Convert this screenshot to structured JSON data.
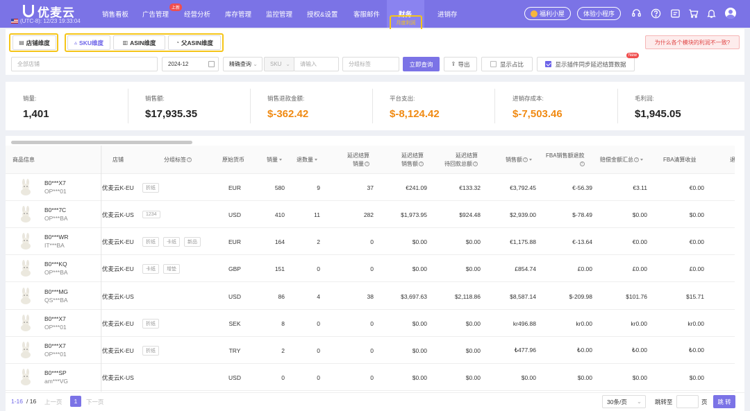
{
  "nav": {
    "logo": "优麦云",
    "timezone": "(UTC-8): 12/23 19:33:04",
    "menu": [
      "销售看板",
      "广告管理",
      "经营分析",
      "库存管理",
      "监控管理",
      "授权&设置",
      "客服邮件",
      "财务",
      "进销存"
    ],
    "ad_badge": "上新",
    "active_submenu": "月度利润",
    "benefits": "福利小屋",
    "miniprogram": "体验小程序",
    "icons": [
      "support-icon",
      "help-icon",
      "message-icon",
      "cart-icon",
      "bell-icon",
      "avatar-icon"
    ]
  },
  "dims": {
    "store": "店铺维度",
    "sku": "SKU维度",
    "asin": "ASIN维度",
    "parent_asin": "父ASIN维度"
  },
  "warning": "为什么各个模块的利润不一致?",
  "filters": {
    "store_placeholder": "全部店铺",
    "month": "2024-12",
    "match": "精确查询",
    "field": "SKU",
    "keyword_placeholder": "请输入",
    "tag_placeholder": "分组标签",
    "query": "立即查询",
    "export": "导出",
    "show_ratio": "显示占比",
    "show_plugin": "显示插件同步延迟结算数据",
    "new_tag": "New"
  },
  "summary": [
    {
      "label": "销量:",
      "value": "1,401",
      "color": "normal"
    },
    {
      "label": "销售额:",
      "value": "$17,935.35",
      "color": "normal"
    },
    {
      "label": "销售退款金额:",
      "value": "$-362.42",
      "color": "orange"
    },
    {
      "label": "平台支出:",
      "value": "$-8,124.42",
      "color": "orange"
    },
    {
      "label": "进销存成本:",
      "value": "$-7,503.46",
      "color": "orange"
    },
    {
      "label": "毛利润:",
      "value": "$1,945.05",
      "color": "normal"
    }
  ],
  "table": {
    "headers": {
      "product": "商品信息",
      "store": "店铺",
      "tags": "分组标签",
      "currency": "原始货币",
      "qty": "销量",
      "refund_qty": "退数量",
      "delay_qty_1": "延迟结算",
      "delay_qty_2": "销量",
      "delay_amt_1": "延迟结算",
      "delay_amt_2": "销售额",
      "delay_pending_1": "延迟结算",
      "delay_pending_2": "待回款总额",
      "sales": "销售额",
      "fba_refund_1": "FBA销售额退款",
      "comp": "赔偿金额汇总",
      "fba_liq": "FBA清算收益",
      "more": "退"
    },
    "rows": [
      {
        "asin": "B0***X7",
        "sku": "OP***01",
        "store": "优麦云K-EU",
        "tags": [
          "折纸"
        ],
        "currency": "EUR",
        "qty": "580",
        "refund": "9",
        "dqty": "37",
        "damt": "€241.09",
        "dpend": "€133.32",
        "sales": "€3,792.45",
        "fba_refund": "€-56.39",
        "comp": "€3.11",
        "liq": "€0.00"
      },
      {
        "asin": "B0***7C",
        "sku": "OP***BA",
        "store": "优麦云K-US",
        "tags": [
          "1234"
        ],
        "currency": "USD",
        "qty": "410",
        "refund": "11",
        "dqty": "282",
        "damt": "$1,973.95",
        "dpend": "$924.48",
        "sales": "$2,939.00",
        "fba_refund": "$-78.49",
        "comp": "$0.00",
        "liq": "$0.00"
      },
      {
        "asin": "B0***WR",
        "sku": "IT***BA",
        "store": "优麦云K-EU",
        "tags": [
          "折纸",
          "卡纸",
          "新品"
        ],
        "currency": "EUR",
        "qty": "164",
        "refund": "2",
        "dqty": "0",
        "damt": "$0.00",
        "dpend": "$0.00",
        "sales": "€1,175.88",
        "fba_refund": "€-13.64",
        "comp": "€0.00",
        "liq": "€0.00"
      },
      {
        "asin": "B0***KQ",
        "sku": "OP***BA",
        "store": "优麦云K-EU",
        "tags": [
          "卡纸",
          "增垫"
        ],
        "currency": "GBP",
        "qty": "151",
        "refund": "0",
        "dqty": "0",
        "damt": "$0.00",
        "dpend": "$0.00",
        "sales": "£854.74",
        "fba_refund": "£0.00",
        "comp": "£0.00",
        "liq": "£0.00"
      },
      {
        "asin": "B0***MG",
        "sku": "QS***BA",
        "store": "优麦云K-US",
        "tags": [],
        "currency": "USD",
        "qty": "86",
        "refund": "4",
        "dqty": "38",
        "damt": "$3,697.63",
        "dpend": "$2,118.86",
        "sales": "$8,587.14",
        "fba_refund": "$-209.98",
        "comp": "$101.76",
        "liq": "$15.71"
      },
      {
        "asin": "B0***X7",
        "sku": "OP***01",
        "store": "优麦云K-EU",
        "tags": [
          "折纸"
        ],
        "currency": "SEK",
        "qty": "8",
        "refund": "0",
        "dqty": "0",
        "damt": "$0.00",
        "dpend": "$0.00",
        "sales": "kr496.88",
        "fba_refund": "kr0.00",
        "comp": "kr0.00",
        "liq": "kr0.00"
      },
      {
        "asin": "B0***X7",
        "sku": "OP***01",
        "store": "优麦云K-EU",
        "tags": [
          "折纸"
        ],
        "currency": "TRY",
        "qty": "2",
        "refund": "0",
        "dqty": "0",
        "damt": "$0.00",
        "dpend": "$0.00",
        "sales": "₺477.96",
        "fba_refund": "₺0.00",
        "comp": "₺0.00",
        "liq": "₺0.00"
      },
      {
        "asin": "B0***SP",
        "sku": "am***VG",
        "store": "优麦云K-US",
        "tags": [],
        "currency": "USD",
        "qty": "0",
        "refund": "0",
        "dqty": "0",
        "damt": "$0.00",
        "dpend": "$0.00",
        "sales": "$0.00",
        "fba_refund": "$0.00",
        "comp": "$0.00",
        "liq": "$0.00"
      }
    ]
  },
  "pager": {
    "range": "1-16",
    "total": "/ 16",
    "prev": "上一页",
    "page": "1",
    "next": "下一页",
    "size": "30条/页",
    "jump": "跳转至",
    "unit": "页",
    "go": "跳 转"
  },
  "colors": {
    "primary": "#7b73e6",
    "highlight": "#f5c518",
    "orange": "#f08a12"
  }
}
